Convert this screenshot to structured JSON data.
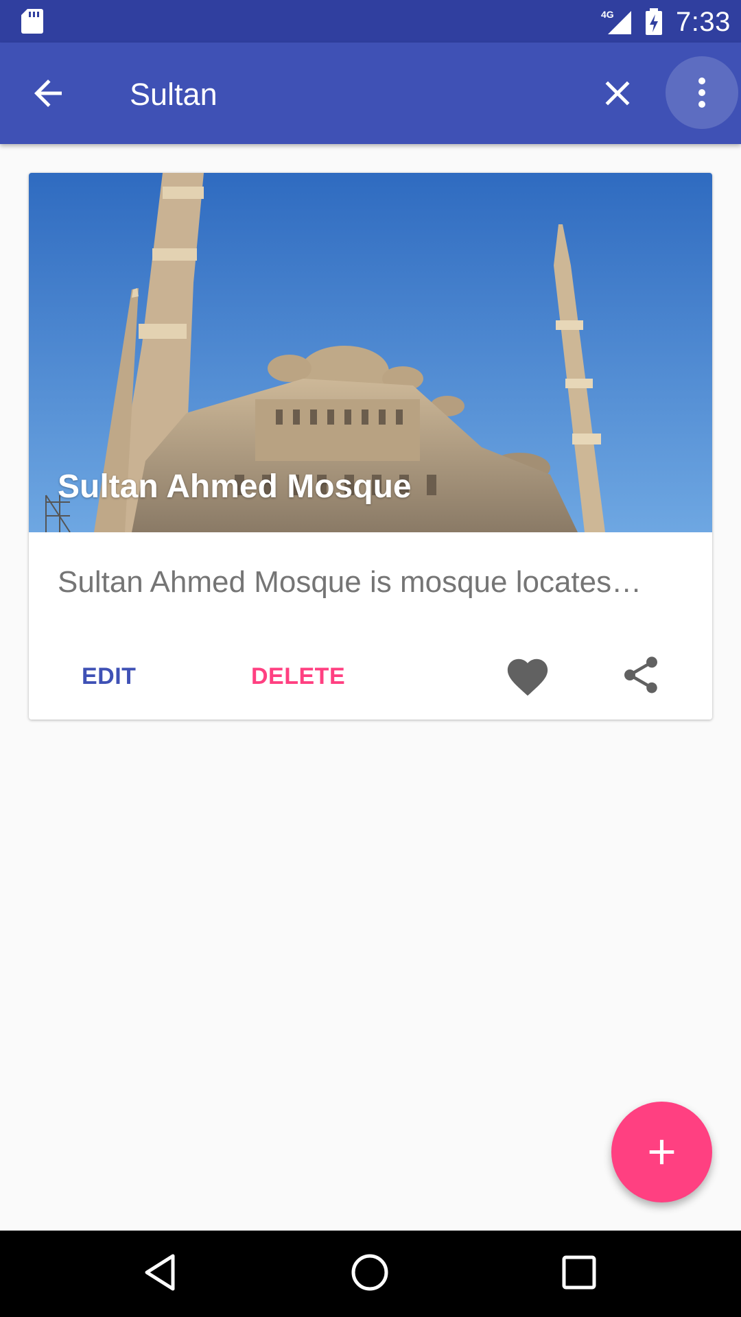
{
  "status_bar": {
    "time": "7:33",
    "network": "4G",
    "icons": [
      "sd-card-icon",
      "signal-icon",
      "battery-charging-icon"
    ]
  },
  "app_bar": {
    "search_query": "Sultan",
    "icons": [
      "back-arrow-icon",
      "close-icon",
      "more-vert-icon"
    ],
    "color": "#3f51b5"
  },
  "results": [
    {
      "title": "Sultan Ahmed Mosque",
      "description": "Sultan Ahmed Mosque is mosque locates…",
      "actions": {
        "edit_label": "EDIT",
        "delete_label": "DELETE",
        "icons": [
          "favorite-icon",
          "share-icon"
        ]
      }
    }
  ],
  "fab": {
    "icon": "add-icon",
    "color": "#ff4081"
  },
  "nav_bar": {
    "icons": [
      "nav-back-icon",
      "nav-home-icon",
      "nav-recents-icon"
    ]
  },
  "colors": {
    "primary": "#3f51b5",
    "primary_dark": "#303f9f",
    "accent": "#ff4081"
  }
}
